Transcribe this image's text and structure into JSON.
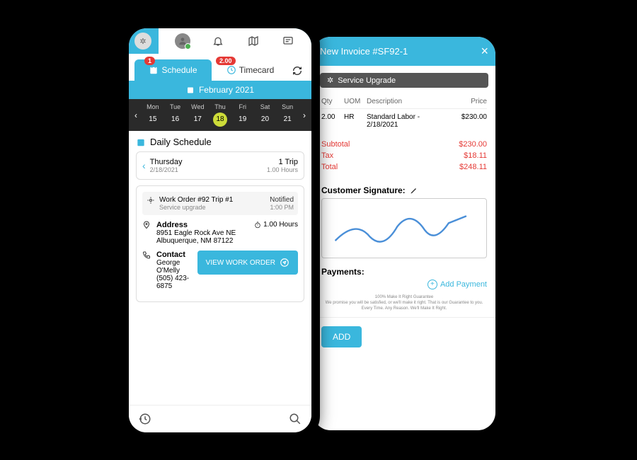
{
  "left": {
    "tabs": {
      "schedule": "Schedule",
      "timecard": "Timecard",
      "badge1": "1",
      "badge2": "2.00"
    },
    "month": "February 2021",
    "days": [
      {
        "name": "Mon",
        "num": "15"
      },
      {
        "name": "Tue",
        "num": "16"
      },
      {
        "name": "Wed",
        "num": "17"
      },
      {
        "name": "Thu",
        "num": "18",
        "selected": true
      },
      {
        "name": "Fri",
        "num": "19"
      },
      {
        "name": "Sat",
        "num": "20"
      },
      {
        "name": "Sun",
        "num": "21"
      }
    ],
    "daily_title": "Daily Schedule",
    "day_card": {
      "day": "Thursday",
      "date": "2/18/2021",
      "trips": "1 Trip",
      "hours": "1.00 Hours"
    },
    "wo": {
      "title": "Work Order #92 Trip #1",
      "sub": "Service upgrade",
      "status": "Notified",
      "time": "1:00 PM"
    },
    "address": {
      "label": "Address",
      "line1": "8951 Eagle Rock Ave NE",
      "line2": "Albuquerque, NM 87122",
      "hours": "1.00 Hours"
    },
    "contact": {
      "label": "Contact",
      "name": "George O'Melly",
      "phone": "(505) 423-6875"
    },
    "view_btn": "VIEW WORK ORDER"
  },
  "right": {
    "title": "New Invoice #SF92-1",
    "service_tag": "Service Upgrade",
    "headers": {
      "qty": "Qty",
      "uom": "UOM",
      "desc": "Description",
      "price": "Price"
    },
    "line": {
      "qty": "2.00",
      "uom": "HR",
      "desc": "Standard Labor - 2/18/2021",
      "price": "$230.00"
    },
    "totals": {
      "subtotal_l": "Subtotal",
      "subtotal_v": "$230.00",
      "tax_l": "Tax",
      "tax_v": "$18.11",
      "total_l": "Total",
      "total_v": "$248.11"
    },
    "sig_label": "Customer Signature:",
    "pay_label": "Payments:",
    "add_payment": "Add Payment",
    "fine1": "100% Make It Right Guarantee",
    "fine2": "We promise you will be satisfied, or we'll make it right. That is our Guarantee to you.",
    "fine3": "Every Time. Any Reason. We'll Make It Right.",
    "add_btn": "ADD"
  }
}
